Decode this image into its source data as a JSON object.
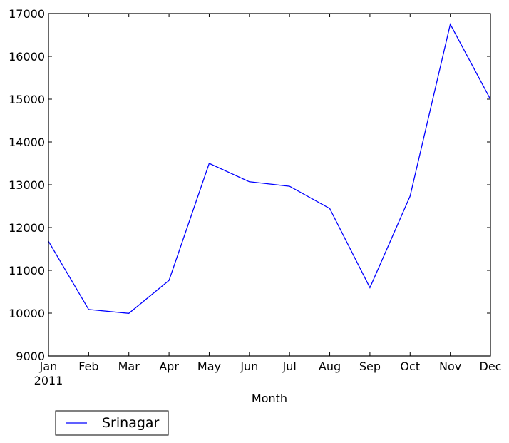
{
  "chart_data": {
    "type": "line",
    "title": "",
    "xlabel": "Month",
    "ylabel": "",
    "categories": [
      "Jan",
      "Feb",
      "Mar",
      "Apr",
      "May",
      "Jun",
      "Jul",
      "Aug",
      "Sep",
      "Oct",
      "Nov",
      "Dec"
    ],
    "x_sublabel_first": "2011",
    "ylim": [
      9000,
      17000
    ],
    "yticks": [
      9000,
      10000,
      11000,
      12000,
      13000,
      14000,
      15000,
      16000,
      17000
    ],
    "grid": false,
    "legend_placement": "below-left, outside plot",
    "series": [
      {
        "name": "Srinagar",
        "color": "#0000ff",
        "values": [
          11680,
          10085,
          9995,
          10765,
          13500,
          13070,
          12965,
          12445,
          10595,
          12735,
          16750,
          14995
        ]
      }
    ]
  }
}
